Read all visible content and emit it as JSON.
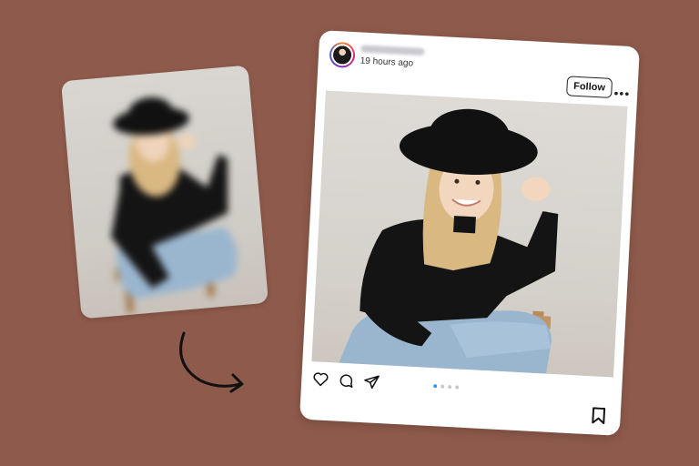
{
  "post": {
    "timestamp": "19 hours ago",
    "follow_label": "Follow",
    "more_label": "•••",
    "carousel": {
      "count": 4,
      "active": 0
    }
  },
  "colors": {
    "background": "#8e5a4b",
    "accent": "#3897f0",
    "sweater": "#141414",
    "jeans": "#9ab6cf",
    "hat": "#111111",
    "hair": "#d9b882"
  },
  "icons": {
    "heart": "heart-icon",
    "comment": "comment-icon",
    "share": "send-icon",
    "bookmark": "bookmark-icon",
    "more": "more-options-icon",
    "arrow": "curved-arrow-icon"
  }
}
